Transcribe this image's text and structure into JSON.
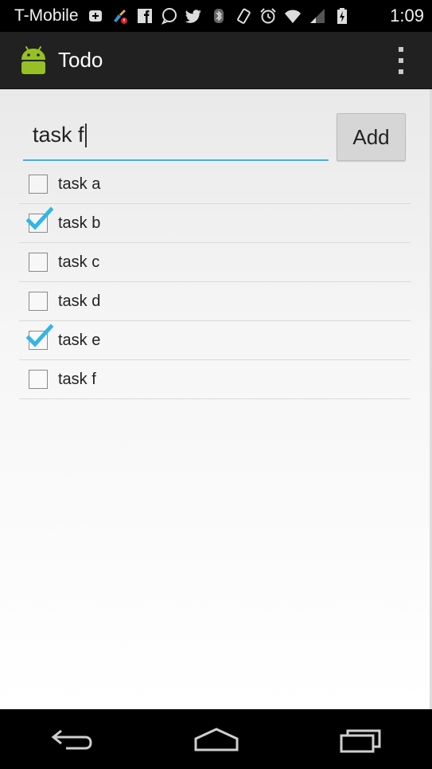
{
  "status_bar": {
    "carrier": "T-Mobile",
    "time": "1:09",
    "icons": [
      "add-box-icon",
      "cleaner-icon",
      "facebook-icon",
      "chat-bubble-icon",
      "twitter-icon",
      "bluetooth-icon",
      "vibrate-icon",
      "alarm-icon",
      "wifi-icon",
      "cell-signal-icon",
      "battery-charging-icon"
    ]
  },
  "action_bar": {
    "title": "Todo",
    "app_icon": "android-icon",
    "menu_icon": "overflow-menu-icon"
  },
  "input": {
    "value": "task f"
  },
  "add_button": {
    "label": "Add"
  },
  "tasks": [
    {
      "label": "task a",
      "checked": false
    },
    {
      "label": "task b",
      "checked": true
    },
    {
      "label": "task c",
      "checked": false
    },
    {
      "label": "task d",
      "checked": false
    },
    {
      "label": "task e",
      "checked": true
    },
    {
      "label": "task f",
      "checked": false
    }
  ],
  "nav_bar": {
    "icons": [
      "back-icon",
      "home-icon",
      "recent-apps-icon"
    ]
  },
  "colors": {
    "accent": "#33b5e5",
    "action_bar": "#212121",
    "android_green": "#97c024"
  }
}
